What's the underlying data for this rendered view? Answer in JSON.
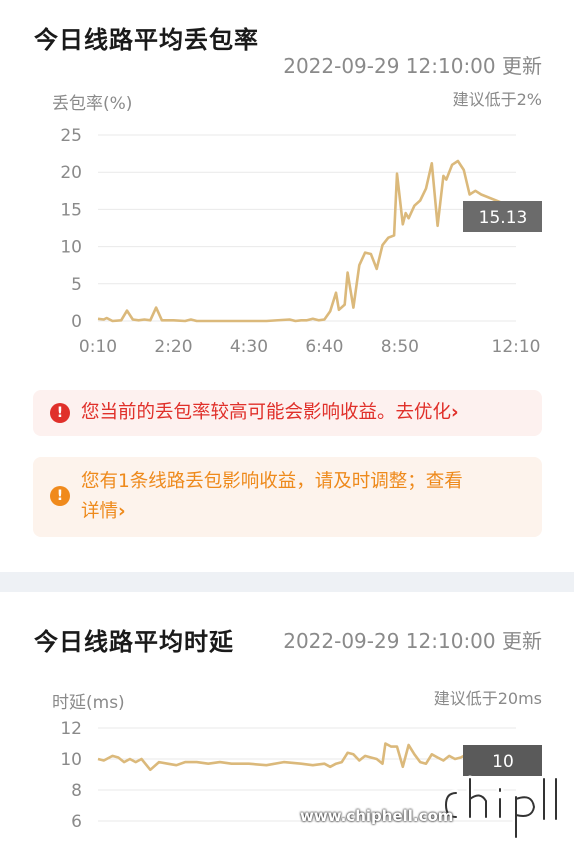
{
  "loss": {
    "title": "今日线路平均丢包率",
    "timestamp": "2022-09-29 12:10:00 更新",
    "y_label": "丢包率(%)",
    "hint": "建议低于2%",
    "tooltip": "15.13",
    "chart_data": {
      "type": "line",
      "title": "今日线路平均丢包率",
      "ylabel": "丢包率(%)",
      "ylim": [
        0,
        25
      ],
      "yticks": [
        0,
        5,
        10,
        15,
        20,
        25
      ],
      "xticks": [
        "0:10",
        "2:20",
        "4:30",
        "6:40",
        "8:50",
        "12:10"
      ],
      "x_range": [
        "0:10",
        "12:10"
      ],
      "series_color": "#dbb97b",
      "grid": true,
      "points": [
        [
          "0:10",
          0.3
        ],
        [
          "0:20",
          0.2
        ],
        [
          "0:25",
          0.4
        ],
        [
          "0:35",
          0.0
        ],
        [
          "0:50",
          0.1
        ],
        [
          "1:00",
          1.4
        ],
        [
          "1:10",
          0.2
        ],
        [
          "1:20",
          0.1
        ],
        [
          "1:30",
          0.2
        ],
        [
          "1:40",
          0.1
        ],
        [
          "1:50",
          1.8
        ],
        [
          "2:00",
          0.1
        ],
        [
          "2:20",
          0.1
        ],
        [
          "2:40",
          0.0
        ],
        [
          "2:50",
          0.2
        ],
        [
          "3:00",
          0.0
        ],
        [
          "4:00",
          0.0
        ],
        [
          "5:00",
          0.0
        ],
        [
          "5:40",
          0.2
        ],
        [
          "5:50",
          0.0
        ],
        [
          "6:00",
          0.1
        ],
        [
          "6:10",
          0.1
        ],
        [
          "6:20",
          0.3
        ],
        [
          "6:30",
          0.1
        ],
        [
          "6:40",
          0.2
        ],
        [
          "6:50",
          1.3
        ],
        [
          "7:00",
          3.8
        ],
        [
          "7:05",
          1.5
        ],
        [
          "7:15",
          2.2
        ],
        [
          "7:20",
          6.5
        ],
        [
          "7:30",
          1.8
        ],
        [
          "7:40",
          7.5
        ],
        [
          "7:50",
          9.2
        ],
        [
          "8:00",
          9.0
        ],
        [
          "8:10",
          7.0
        ],
        [
          "8:20",
          10.2
        ],
        [
          "8:30",
          11.2
        ],
        [
          "8:40",
          11.5
        ],
        [
          "8:45",
          19.8
        ],
        [
          "8:55",
          13.0
        ],
        [
          "9:00",
          14.5
        ],
        [
          "9:05",
          13.8
        ],
        [
          "9:15",
          15.5
        ],
        [
          "9:25",
          16.2
        ],
        [
          "9:35",
          17.8
        ],
        [
          "9:45",
          21.2
        ],
        [
          "9:55",
          12.8
        ],
        [
          "10:05",
          19.5
        ],
        [
          "10:10",
          19.0
        ],
        [
          "10:20",
          21.0
        ],
        [
          "10:30",
          21.5
        ],
        [
          "10:40",
          20.3
        ],
        [
          "10:50",
          17.0
        ],
        [
          "11:00",
          17.5
        ],
        [
          "11:10",
          17.0
        ],
        [
          "12:10",
          15.13
        ]
      ]
    },
    "alerts": [
      {
        "text": "您当前的丢包率较高可能会影响收益。去优化",
        "icon": "!"
      },
      {
        "text_line1": "您有1条线路丢包影响收益，请及时调整；查看",
        "text_line2": "详情",
        "icon": "!"
      }
    ]
  },
  "latency": {
    "title": "今日线路平均时延",
    "timestamp": "2022-09-29 12:10:00 更新",
    "y_label": "时延(ms)",
    "hint": "建议低于20ms",
    "tooltip": "10",
    "chart_data": {
      "type": "line",
      "title": "今日线路平均时延",
      "ylabel": "时延(ms)",
      "ylim": [
        6,
        12
      ],
      "yticks": [
        6,
        8,
        10,
        12
      ],
      "series_color": "#dbb97b",
      "grid": true,
      "points": [
        [
          "0:10",
          10.0
        ],
        [
          "0:20",
          9.9
        ],
        [
          "0:35",
          10.2
        ],
        [
          "0:45",
          10.1
        ],
        [
          "0:55",
          9.8
        ],
        [
          "1:05",
          10.0
        ],
        [
          "1:15",
          9.8
        ],
        [
          "1:25",
          10.0
        ],
        [
          "1:40",
          9.3
        ],
        [
          "1:55",
          9.8
        ],
        [
          "2:10",
          9.7
        ],
        [
          "2:25",
          9.6
        ],
        [
          "2:40",
          9.8
        ],
        [
          "3:00",
          9.8
        ],
        [
          "3:20",
          9.7
        ],
        [
          "3:40",
          9.8
        ],
        [
          "4:00",
          9.7
        ],
        [
          "4:30",
          9.7
        ],
        [
          "5:00",
          9.6
        ],
        [
          "5:30",
          9.8
        ],
        [
          "6:00",
          9.7
        ],
        [
          "6:20",
          9.6
        ],
        [
          "6:40",
          9.7
        ],
        [
          "6:50",
          9.5
        ],
        [
          "7:00",
          9.7
        ],
        [
          "7:10",
          9.8
        ],
        [
          "7:20",
          10.4
        ],
        [
          "7:30",
          10.3
        ],
        [
          "7:40",
          9.9
        ],
        [
          "7:50",
          10.2
        ],
        [
          "8:00",
          10.1
        ],
        [
          "8:10",
          10.0
        ],
        [
          "8:20",
          9.7
        ],
        [
          "8:25",
          11.0
        ],
        [
          "8:35",
          10.8
        ],
        [
          "8:45",
          10.8
        ],
        [
          "8:55",
          9.5
        ],
        [
          "9:05",
          10.9
        ],
        [
          "9:15",
          10.3
        ],
        [
          "9:25",
          9.8
        ],
        [
          "9:35",
          9.7
        ],
        [
          "9:45",
          10.3
        ],
        [
          "9:55",
          10.1
        ],
        [
          "10:05",
          9.9
        ],
        [
          "10:15",
          10.2
        ],
        [
          "10:25",
          10.0
        ],
        [
          "10:35",
          10.1
        ],
        [
          "10:45",
          10.3
        ],
        [
          "10:55",
          10.2
        ],
        [
          "11:10",
          10.0
        ],
        [
          "11:30",
          10.0
        ],
        [
          "12:10",
          10.0
        ]
      ]
    }
  },
  "watermark": {
    "text": "www.chiphell.com",
    "logo": "chiphell"
  }
}
